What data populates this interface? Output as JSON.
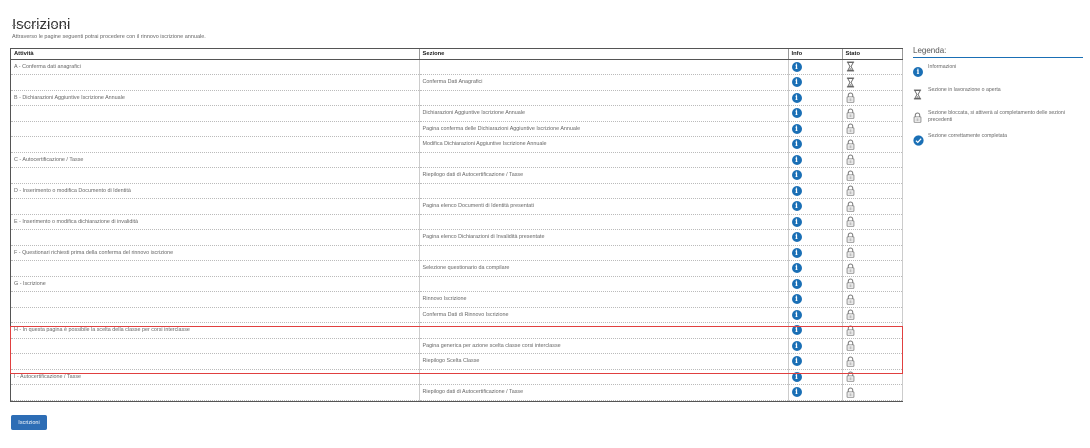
{
  "page": {
    "title": "Iscrizioni",
    "intro": "Attraverso le pagine seguenti potrai procedere con il rinnovo iscrizione annuale."
  },
  "table": {
    "headers": {
      "attivita": "Attività",
      "sezione": "Sezione",
      "info": "Info",
      "stato": "Stato"
    },
    "rows": [
      {
        "attivita": "A - Conferma dati anagrafici",
        "sezione": "",
        "stato": "hourglass-icon"
      },
      {
        "attivita": "",
        "sezione": "Conferma Dati Anagrafici",
        "stato": "hourglass-icon"
      },
      {
        "attivita": "B - Dichiarazioni Aggiuntive Iscrizione Annuale",
        "sezione": "",
        "stato": "lock-icon"
      },
      {
        "attivita": "",
        "sezione": "Dichiarazioni Aggiuntive Iscrizione Annuale",
        "stato": "lock-icon"
      },
      {
        "attivita": "",
        "sezione": "Pagina conferma delle Dichiarazioni Aggiuntive Iscrizione Annuale",
        "stato": "lock-icon"
      },
      {
        "attivita": "",
        "sezione": "Modifica Dichiarazioni Aggiuntive Iscrizione Annuale",
        "stato": "lock-icon"
      },
      {
        "attivita": "C - Autocertificazione / Tasse",
        "sezione": "",
        "stato": "lock-icon"
      },
      {
        "attivita": "",
        "sezione": "Riepilogo dati di Autocertificazione / Tasse",
        "stato": "lock-icon"
      },
      {
        "attivita": "D - Inserimento o modifica Documento di Identità",
        "sezione": "",
        "stato": "lock-icon"
      },
      {
        "attivita": "",
        "sezione": "Pagina elenco Documenti di Identità presentati",
        "stato": "lock-icon"
      },
      {
        "attivita": "E - Inserimento o modifica dichiarazione di invalidità",
        "sezione": "",
        "stato": "lock-icon"
      },
      {
        "attivita": "",
        "sezione": "Pagina elenco Dichiarazioni di Invalidità presentate",
        "stato": "lock-icon"
      },
      {
        "attivita": "F - Questionari richiesti prima della conferma del rinnovo iscrizione",
        "sezione": "",
        "stato": "lock-icon"
      },
      {
        "attivita": "",
        "sezione": "Selezione questionario da compilare",
        "stato": "lock-icon"
      },
      {
        "attivita": "G - Iscrizione",
        "sezione": "",
        "stato": "lock-icon"
      },
      {
        "attivita": "",
        "sezione": "Rinnovo Iscrizione",
        "stato": "lock-icon"
      },
      {
        "attivita": "",
        "sezione": "Conferma Dati di Rinnovo Iscrizione",
        "stato": "lock-icon"
      },
      {
        "attivita": "H - In questa pagina è possibile la scelta della classe per corsi interclasse",
        "sezione": "",
        "stato": "lock-icon"
      },
      {
        "attivita": "",
        "sezione": "Pagina generica per azione scelta classe corsi interclasse",
        "stato": "lock-icon"
      },
      {
        "attivita": "",
        "sezione": "Riepilogo Scelta Classe",
        "stato": "lock-icon"
      },
      {
        "attivita": "I - Autocertificazione / Tasse",
        "sezione": "",
        "stato": "lock-icon"
      },
      {
        "attivita": "",
        "sezione": "Riepilogo dati di Autocertificazione / Tasse",
        "stato": "lock-icon"
      }
    ]
  },
  "legend": {
    "title": "Legenda:",
    "items": [
      {
        "icon": "info-icon",
        "text": "Informazioni"
      },
      {
        "icon": "hourglass-icon",
        "text": "Sezione in lavorazione o aperta"
      },
      {
        "icon": "lock-icon",
        "text": "Sezione bloccata, si attiverà al completamento delle sezioni precedenti"
      },
      {
        "icon": "check-icon",
        "text": "Sezione correttamente completata"
      }
    ]
  },
  "button": {
    "label": "Iscrizioni"
  },
  "colors": {
    "accent": "#1a6fb5",
    "highlight": "#e04040",
    "button": "#2d6db5"
  }
}
